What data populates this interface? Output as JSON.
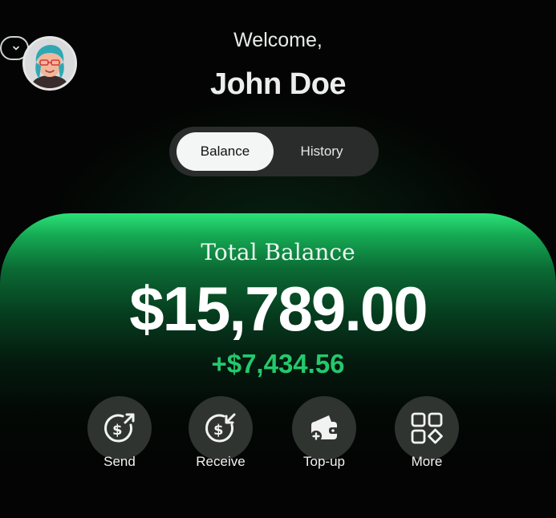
{
  "header": {
    "greeting": "Welcome,",
    "user_name": "John Doe"
  },
  "tabs": [
    {
      "label": "Balance",
      "active": true
    },
    {
      "label": "History",
      "active": false
    }
  ],
  "balance": {
    "title": "Total Balance",
    "amount": "$15,789.00",
    "change": "+$7,434.56"
  },
  "actions": [
    {
      "label": "Send",
      "icon": "send-money-icon"
    },
    {
      "label": "Receive",
      "icon": "receive-money-icon"
    },
    {
      "label": "Top-up",
      "icon": "wallet-topup-icon"
    },
    {
      "label": "More",
      "icon": "grid-more-icon"
    }
  ],
  "colors": {
    "background": "#030403",
    "accent_green": "#2be178",
    "change_green": "#24c96c",
    "segment_bg": "#2a2c2b",
    "action_bg": "#2f3431"
  }
}
